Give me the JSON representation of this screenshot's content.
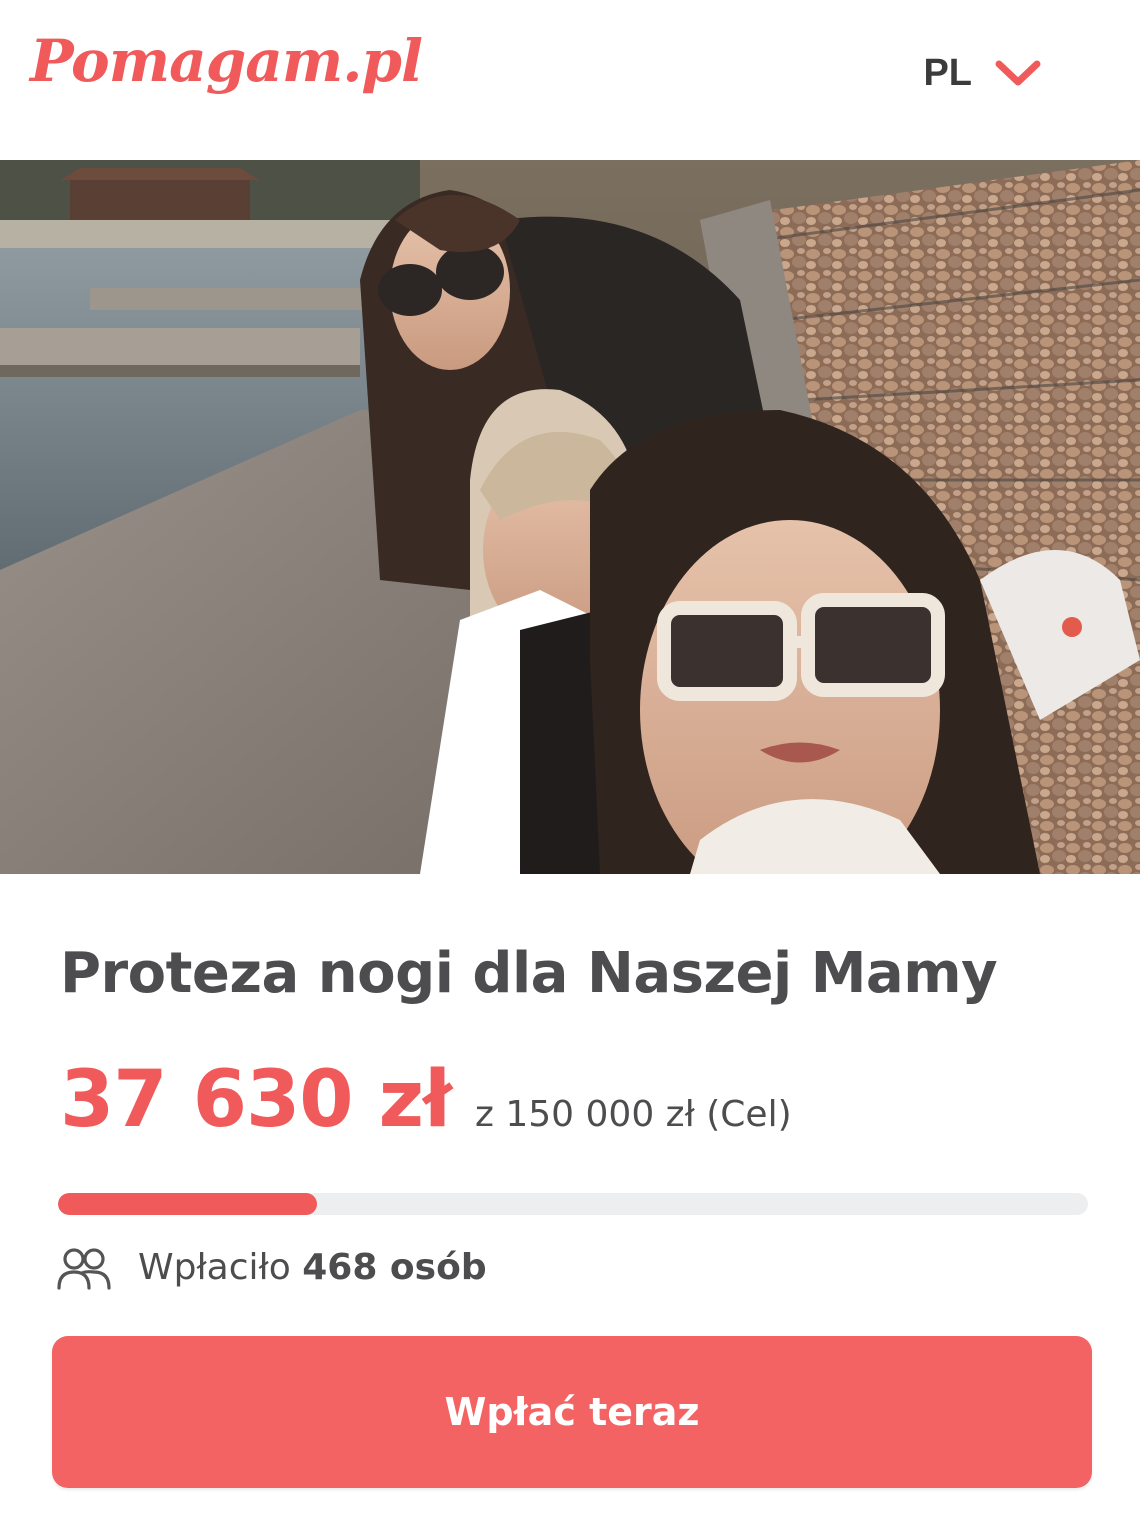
{
  "brand": {
    "logo_text": "Pomagam.pl",
    "accent_color": "#f05a5b"
  },
  "header": {
    "language": "PL",
    "language_icon": "chevron-down-icon"
  },
  "campaign": {
    "hero_image": "photo of three women wearing sunglasses on a lakeside pier",
    "title": "Proteza nogi dla Naszej Mamy",
    "raised": "37 630 zł",
    "goal_text": "z 150 000 zł (Cel)",
    "progress_fraction": 0.251,
    "donors_prefix": "Wpłaciło",
    "donors_count": "468 osób",
    "donors_icon": "people-icon",
    "cta_label": "Wpłać teraz"
  }
}
